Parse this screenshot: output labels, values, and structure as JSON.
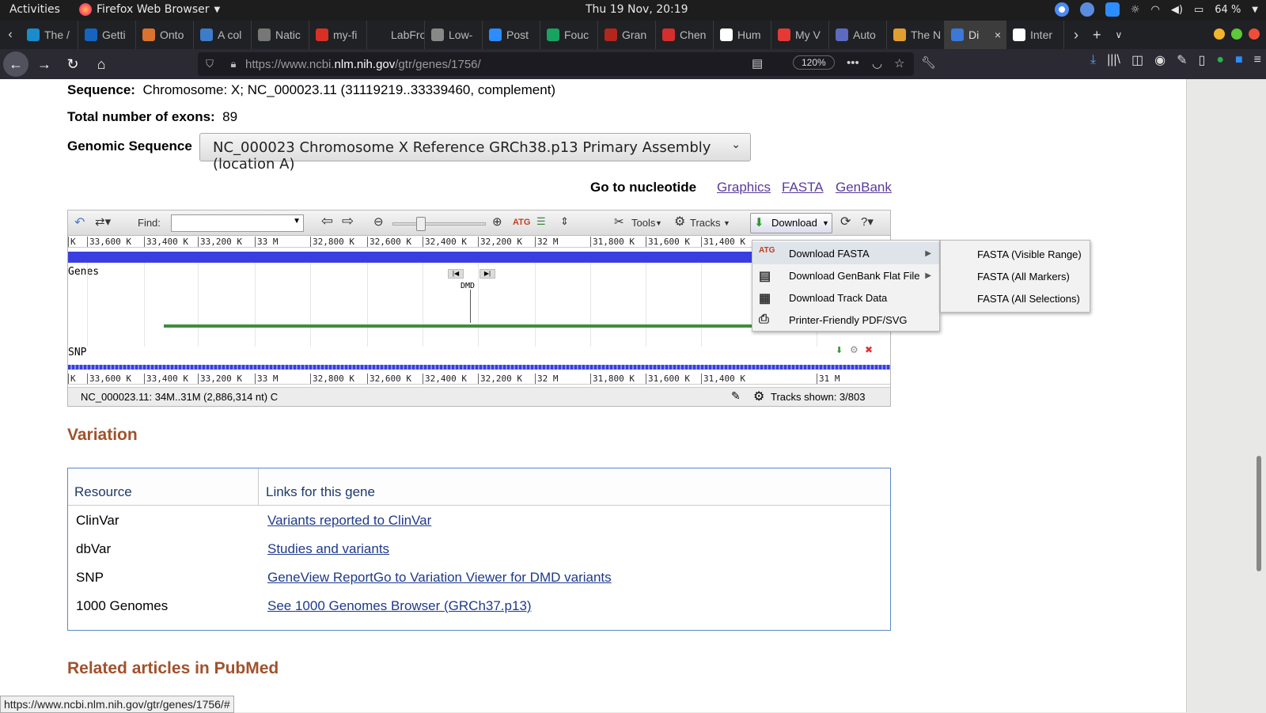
{
  "topbar": {
    "activities": "Activities",
    "app": "Firefox Web Browser",
    "clock": "Thu 19 Nov, 20:19",
    "battery": "64 %"
  },
  "tabs": [
    {
      "label": "The /",
      "color": "#1a8ccc"
    },
    {
      "label": "Getti",
      "color": "#1565c0"
    },
    {
      "label": "Onto",
      "color": "#d9732f"
    },
    {
      "label": "A col",
      "color": "#3d7cc9"
    },
    {
      "label": "Natic",
      "color": "#777777"
    },
    {
      "label": "my-fi",
      "color": "#d93025"
    },
    {
      "label": "LabFron",
      "color": "#202124"
    },
    {
      "label": "Low-",
      "color": "#888888"
    },
    {
      "label": "Post",
      "color": "#2d8cff"
    },
    {
      "label": "Fouc",
      "color": "#1aa260"
    },
    {
      "label": "Gran",
      "color": "#b3261e"
    },
    {
      "label": "Chen",
      "color": "#d32f2f"
    },
    {
      "label": "Hum",
      "color": "#ffffff"
    },
    {
      "label": "My V",
      "color": "#e53935"
    },
    {
      "label": "Auto",
      "color": "#5c6bc0"
    },
    {
      "label": "The N",
      "color": "#e0a030"
    },
    {
      "label": "Di",
      "color": "#3c78d8",
      "active": true
    },
    {
      "label": "Inter",
      "color": "#ffffff"
    }
  ],
  "navbar": {
    "url_prefix": "https://www.ncbi.",
    "url_domain": "nlm.nih.gov",
    "url_suffix": "/gtr/genes/1756/",
    "zoom": "120%"
  },
  "page": {
    "sequence_label": "Sequence:",
    "sequence_value": "Chromosome: X; NC_000023.11 (31119219..33339460, complement)",
    "exons_label": "Total number of exons:",
    "exons_value": "89",
    "genomic_label": "Genomic Sequence",
    "genomic_select": "NC_000023 Chromosome X Reference GRCh38.p13 Primary Assembly (location A)",
    "goto_label": "Go to nucleotide",
    "links": [
      "Graphics",
      "FASTA",
      "GenBank"
    ]
  },
  "viewer": {
    "find_label": "Find:",
    "tools": "Tools",
    "tracks": "Tracks",
    "download": "Download",
    "ruler_ticks": [
      "K",
      "33,600 K",
      "33,400 K",
      "33,200 K",
      "33 M",
      "32,800 K",
      "32,600 K",
      "32,400 K",
      "32,200 K",
      "32 M",
      "31,800 K",
      "31,600 K",
      "31,400 K",
      "31 M"
    ],
    "genes_label": "Genes",
    "gene_name": "DMD",
    "snp_label": "SNP",
    "status_left": "NC_000023.11: 34M..31M (2,886,314 nt) C",
    "status_right": "Tracks shown: 3/803"
  },
  "download_menu": [
    {
      "label": "Download FASTA",
      "icon": "fasta-icon",
      "submenu": true
    },
    {
      "label": "Download GenBank Flat File",
      "icon": "file-icon",
      "submenu": true
    },
    {
      "label": "Download Track Data",
      "icon": "table-icon",
      "submenu": false
    },
    {
      "label": "Printer-Friendly PDF/SVG",
      "icon": "printer-icon",
      "submenu": false
    }
  ],
  "fasta_submenu": [
    "FASTA (Visible Range)",
    "FASTA (All Markers)",
    "FASTA (All Selections)"
  ],
  "variation": {
    "heading": "Variation",
    "col_resource": "Resource",
    "col_links": "Links for this gene",
    "rows": [
      {
        "resource": "ClinVar",
        "link": "Variants reported to ClinVar"
      },
      {
        "resource": "dbVar",
        "link": "Studies and variants"
      },
      {
        "resource": "SNP",
        "link": "GeneView ReportGo to Variation Viewer for DMD variants"
      },
      {
        "resource": "1000 Genomes",
        "link": "See 1000 Genomes Browser (GRCh37.p13)"
      }
    ]
  },
  "pubmed_heading": "Related articles in PubMed",
  "status_url": "https://www.ncbi.nlm.nih.gov/gtr/genes/1756/#"
}
